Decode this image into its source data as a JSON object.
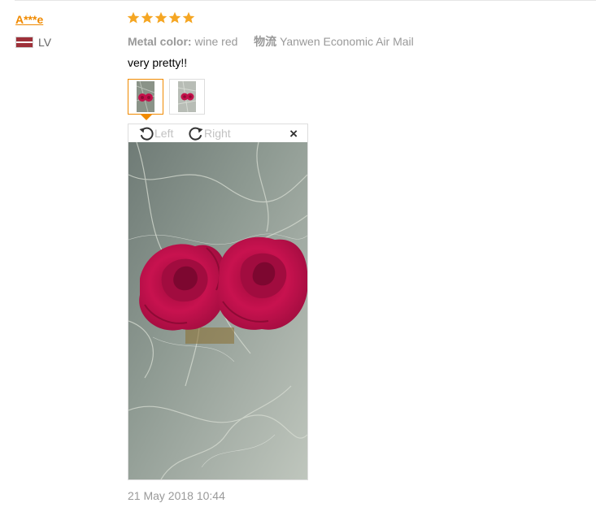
{
  "review": {
    "user": "A***e",
    "country": "LV",
    "rating": 5,
    "attributes": [
      {
        "label": "Metal color:",
        "value": "wine red"
      },
      {
        "label": "物流",
        "value": "Yanwen Economic Air Mail"
      }
    ],
    "text": "very pretty!!",
    "date": "21 May 2018 10:44"
  },
  "viewer": {
    "rotate_left_label": "Left",
    "rotate_right_label": "Right",
    "close_glyph": "×"
  },
  "icons": {
    "star": "star-icon",
    "rotate_left": "rotate-left-icon",
    "rotate_right": "rotate-right-icon",
    "close": "close-icon",
    "flag": "latvia-flag-icon"
  },
  "colors": {
    "accent": "#f08a00",
    "star": "#f5a623",
    "meta_text": "#999999",
    "rose": "#c2114a"
  }
}
